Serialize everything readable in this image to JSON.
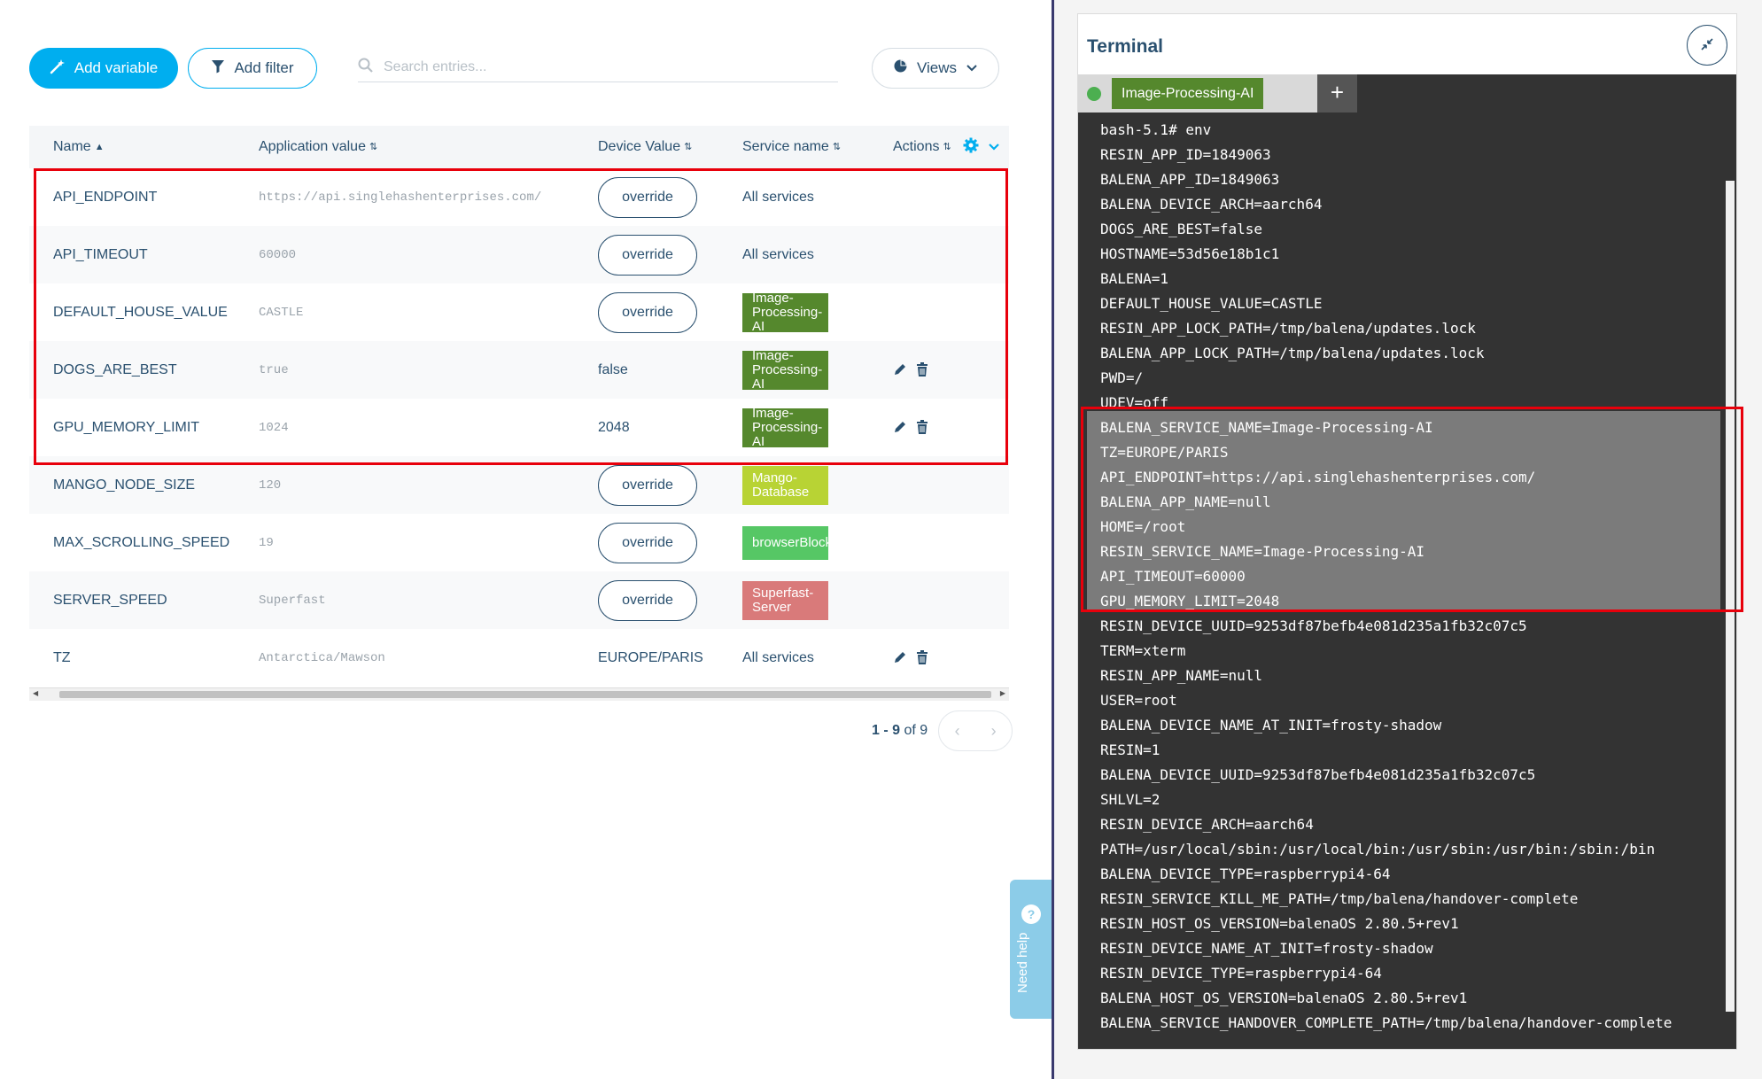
{
  "toolbar": {
    "add_variable": "Add variable",
    "add_filter": "Add filter",
    "search_placeholder": "Search entries...",
    "views": "Views"
  },
  "table": {
    "headers": {
      "name": "Name",
      "application_value": "Application value",
      "device_value": "Device Value",
      "service_name": "Service name",
      "actions": "Actions"
    },
    "override_label": "override",
    "rows": [
      {
        "name": "API_ENDPOINT",
        "app_value": "https://api.singlehashenterprises.com/",
        "device_value": "",
        "override": true,
        "service": "All services",
        "service_tag": false,
        "actions": false
      },
      {
        "name": "API_TIMEOUT",
        "app_value": "60000",
        "device_value": "",
        "override": true,
        "service": "All services",
        "service_tag": false,
        "actions": false
      },
      {
        "name": "DEFAULT_HOUSE_VALUE",
        "app_value": "CASTLE",
        "device_value": "",
        "override": true,
        "service": "Image-Processing-AI",
        "service_tag": true,
        "service_color": "#55882d",
        "actions": false
      },
      {
        "name": "DOGS_ARE_BEST",
        "app_value": "true",
        "device_value": "false",
        "override": false,
        "service": "Image-Processing-AI",
        "service_tag": true,
        "service_color": "#55882d",
        "actions": true
      },
      {
        "name": "GPU_MEMORY_LIMIT",
        "app_value": "1024",
        "device_value": "2048",
        "override": false,
        "service": "Image-Processing-AI",
        "service_tag": true,
        "service_color": "#55882d",
        "actions": true
      },
      {
        "name": "MANGO_NODE_SIZE",
        "app_value": "120",
        "device_value": "",
        "override": true,
        "service": "Mango-Database",
        "service_tag": true,
        "service_color": "#b8d334",
        "actions": false
      },
      {
        "name": "MAX_SCROLLING_SPEED",
        "app_value": "19",
        "device_value": "",
        "override": true,
        "service": "browserBlock",
        "service_tag": true,
        "service_color": "#56c765",
        "actions": false
      },
      {
        "name": "SERVER_SPEED",
        "app_value": "Superfast",
        "device_value": "",
        "override": true,
        "service": "Superfast-Server",
        "service_tag": true,
        "service_color": "#d97a7a",
        "actions": false
      },
      {
        "name": "TZ",
        "app_value": "Antarctica/Mawson",
        "device_value": "EUROPE/PARIS",
        "override": false,
        "service": "All services",
        "service_tag": false,
        "actions": true
      }
    ]
  },
  "pagination": {
    "range": "1 - 9",
    "of_total": "of 9"
  },
  "need_help": "Need help",
  "terminal": {
    "title": "Terminal",
    "tab_label": "Image-Processing-AI",
    "lines": [
      "bash-5.1# env",
      "RESIN_APP_ID=1849063",
      "BALENA_APP_ID=1849063",
      "BALENA_DEVICE_ARCH=aarch64",
      "DOGS_ARE_BEST=false",
      "HOSTNAME=53d56e18b1c1",
      "BALENA=1",
      "DEFAULT_HOUSE_VALUE=CASTLE",
      "RESIN_APP_LOCK_PATH=/tmp/balena/updates.lock",
      "BALENA_APP_LOCK_PATH=/tmp/balena/updates.lock",
      "PWD=/",
      "UDEV=off",
      "BALENA_SERVICE_NAME=Image-Processing-AI",
      "TZ=EUROPE/PARIS",
      "API_ENDPOINT=https://api.singlehashenterprises.com/",
      "BALENA_APP_NAME=null",
      "HOME=/root",
      "RESIN_SERVICE_NAME=Image-Processing-AI",
      "API_TIMEOUT=60000",
      "GPU_MEMORY_LIMIT=2048",
      "RESIN_DEVICE_UUID=9253df87befb4e081d235a1fb32c07c5",
      "TERM=xterm",
      "RESIN_APP_NAME=null",
      "USER=root",
      "BALENA_DEVICE_NAME_AT_INIT=frosty-shadow",
      "RESIN=1",
      "BALENA_DEVICE_UUID=9253df87befb4e081d235a1fb32c07c5",
      "SHLVL=2",
      "RESIN_DEVICE_ARCH=aarch64",
      "PATH=/usr/local/sbin:/usr/local/bin:/usr/sbin:/usr/bin:/sbin:/bin",
      "BALENA_DEVICE_TYPE=raspberrypi4-64",
      "RESIN_SERVICE_KILL_ME_PATH=/tmp/balena/handover-complete",
      "RESIN_HOST_OS_VERSION=balenaOS 2.80.5+rev1",
      "RESIN_DEVICE_NAME_AT_INIT=frosty-shadow",
      "RESIN_DEVICE_TYPE=raspberrypi4-64",
      "BALENA_HOST_OS_VERSION=balenaOS 2.80.5+rev1",
      "BALENA_SERVICE_HANDOVER_COMPLETE_PATH=/tmp/balena/handover-complete"
    ]
  },
  "colors": {
    "accent": "#00aeef",
    "highlight_box": "#e8000b",
    "terminal_bg": "#333333"
  }
}
